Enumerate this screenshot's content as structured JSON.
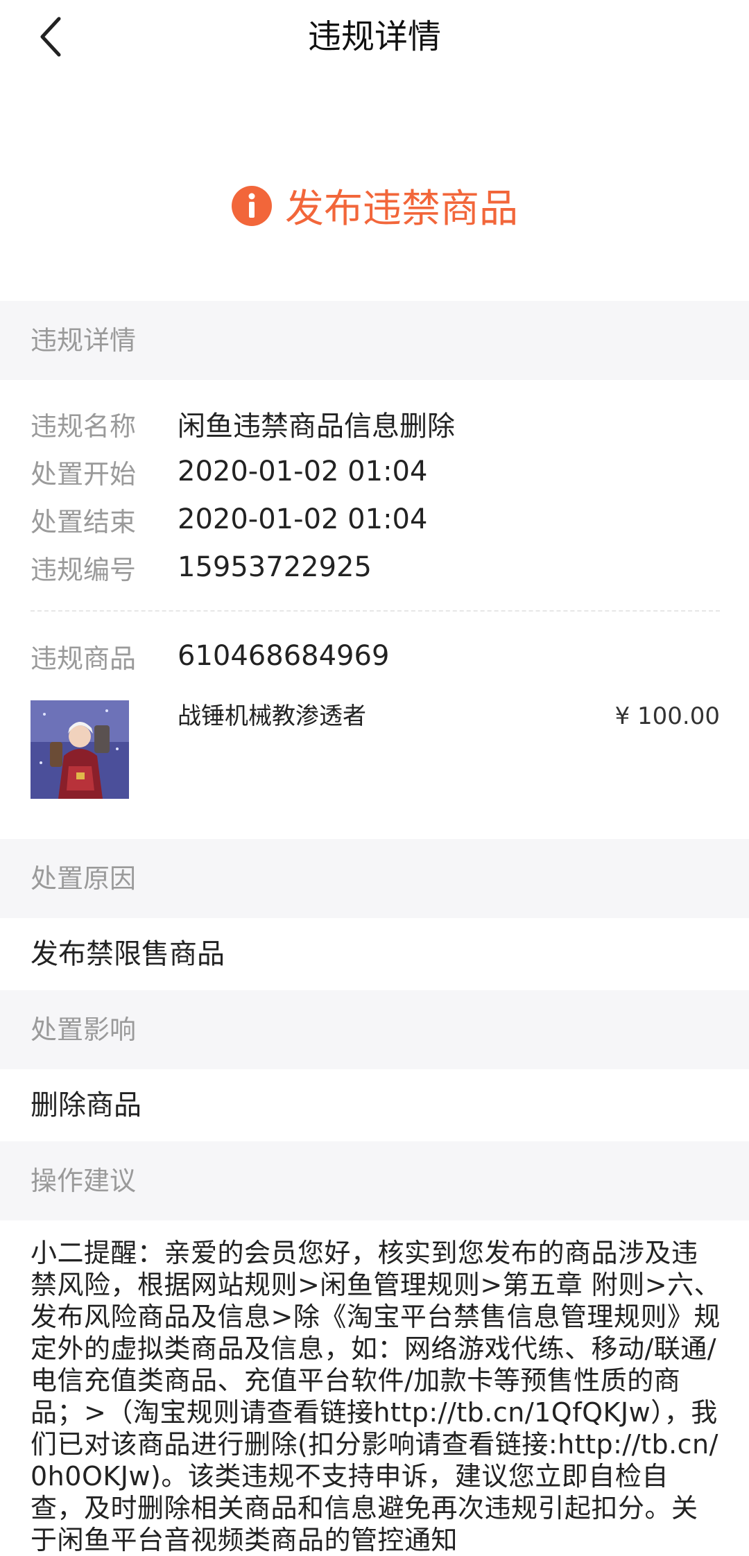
{
  "nav": {
    "title": "违规详情"
  },
  "banner": {
    "icon": "info-icon",
    "title": "发布违禁商品",
    "color": "#f2663a"
  },
  "sections": {
    "details_header": "违规详情",
    "reason_header": "处置原因",
    "impact_header": "处置影响",
    "advice_header": "操作建议"
  },
  "details": {
    "rows": [
      {
        "label": "违规名称",
        "value": "闲鱼违禁商品信息删除"
      },
      {
        "label": "处置开始",
        "value": "2020-01-02 01:04"
      },
      {
        "label": "处置结束",
        "value": "2020-01-02 01:04"
      },
      {
        "label": "违规编号",
        "value": "15953722925"
      }
    ],
    "product": {
      "label": "违规商品",
      "id": "610468684969",
      "name": "战锤机械教渗透者",
      "price": "¥ 100.00"
    }
  },
  "reason": {
    "text": "发布禁限售商品"
  },
  "impact": {
    "text": "删除商品"
  },
  "advice": {
    "text": "小二提醒：亲爱的会员您好，核实到您发布的商品涉及违禁风险，根据网站规则>闲鱼管理规则>第五章 附则>六、发布风险商品及信息>除《淘宝平台禁售信息管理规则》规定外的虚拟类商品及信息，如：网络游戏代练、移动/联通/电信充值类商品、充值平台软件/加款卡等预售性质的商品；>（淘宝规则请查看链接http://tb.cn/1QfQKJw），我们已对该商品进行删除(扣分影响请查看链接:http://tb.cn/0h0OKJw)。该类违规不支持申诉，建议您立即自检自查，及时删除相关商品和信息避免再次违规引起扣分。关于闲鱼平台音视频类商品的管控通知"
  }
}
